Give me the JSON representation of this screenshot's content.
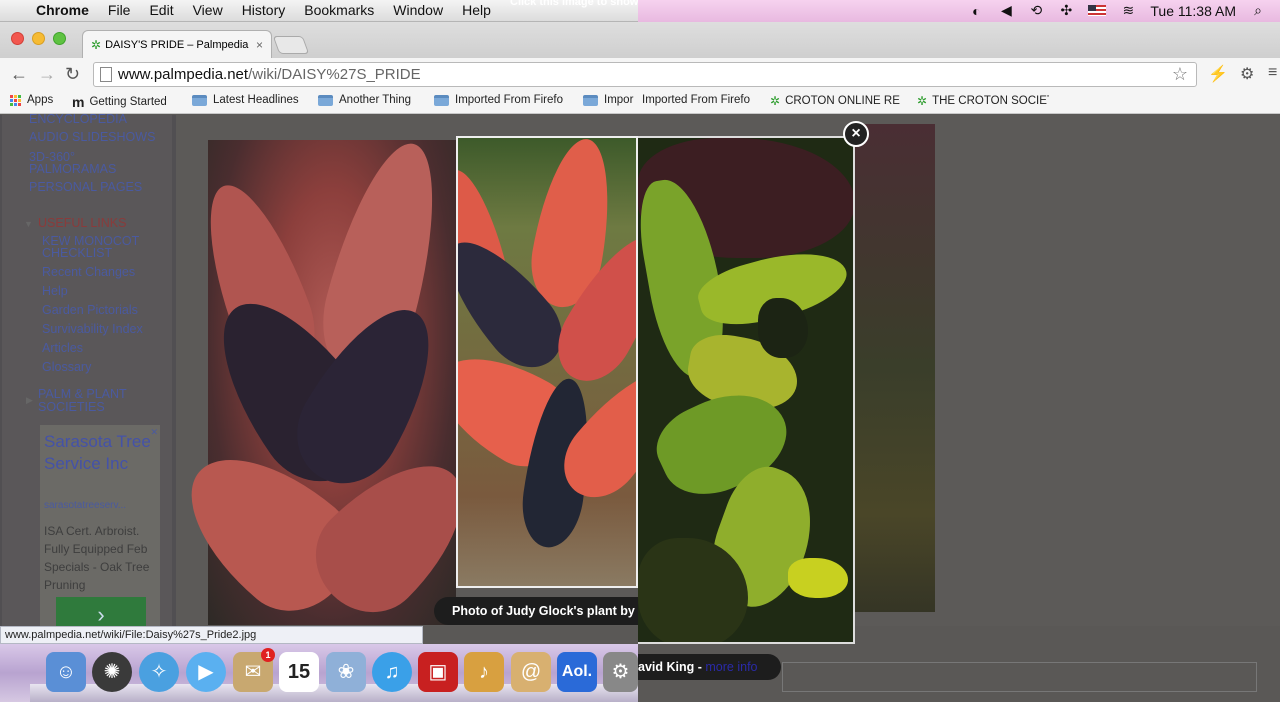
{
  "menubar": {
    "app": "Chrome",
    "items": [
      "File",
      "Edit",
      "View",
      "History",
      "Bookmarks",
      "Window",
      "Help"
    ],
    "overlay_text": "Click this image to show",
    "clock": "Tue 11:38 AM"
  },
  "tab": {
    "title": "DAISY'S PRIDE – Palmpedia",
    "close": "×"
  },
  "toolbar": {
    "url_host": "www.palmpedia.net",
    "url_path": "/wiki/DAISY%27S_PRIDE"
  },
  "bookmarks": [
    {
      "label": "Apps",
      "icon": "apps-grid-icon"
    },
    {
      "label": "Getting Started",
      "icon": "gs-icon"
    },
    {
      "label": "Latest Headlines",
      "icon": "folder-icon"
    },
    {
      "label": "Another Thing",
      "icon": "folder-icon"
    },
    {
      "label": "Imported From Firefo",
      "icon": "folder-icon"
    },
    {
      "label": "Impor",
      "icon": "folder-icon"
    },
    {
      "label": "Imported From Firefo",
      "icon": "none"
    },
    {
      "label": "CROTON ONLINE RE",
      "icon": "palm-icon"
    },
    {
      "label": "THE CROTON SOCIET",
      "icon": "palm-icon"
    }
  ],
  "sidebar": {
    "top_links": [
      "ENCYCLOPEDIA",
      "AUDIO SLIDESHOWS",
      "3D-360°",
      "PALMORAMAS",
      "PERSONAL PAGES"
    ],
    "useful_heading": "USEFUL LINKS",
    "useful_links": [
      "KEW MONOCOT",
      "CHECKLIST",
      "Recent Changes",
      "Help",
      "Garden Pictorials",
      "Survivability Index",
      "Articles",
      "Glossary"
    ],
    "societies_line1": "PALM & PLANT",
    "societies_line2": "SOCIETIES"
  },
  "ad": {
    "title": "Sarasota Tree Service Inc",
    "url": "sarasotatreeserv...",
    "body": "ISA Cert. Arbroist. Fully Equipped Feb Specials - Oak Tree Pruning",
    "button": "›",
    "close": "✕"
  },
  "lightbox": {
    "close": "×",
    "caption_left": "Photo of Judy Glock's plant by",
    "caption_right": "avid King -",
    "caption_more": "more info"
  },
  "statusbar": {
    "text": "www.palmpedia.net/wiki/File:Daisy%27s_Pride2.jpg"
  },
  "dock": {
    "calendar_day": "15",
    "mail_badge": "1",
    "aol": "Aol."
  },
  "colors": {
    "menubar_tint": "#f0c8e8",
    "page_bg": "#5c5a58",
    "link": "#4a5aa0"
  }
}
